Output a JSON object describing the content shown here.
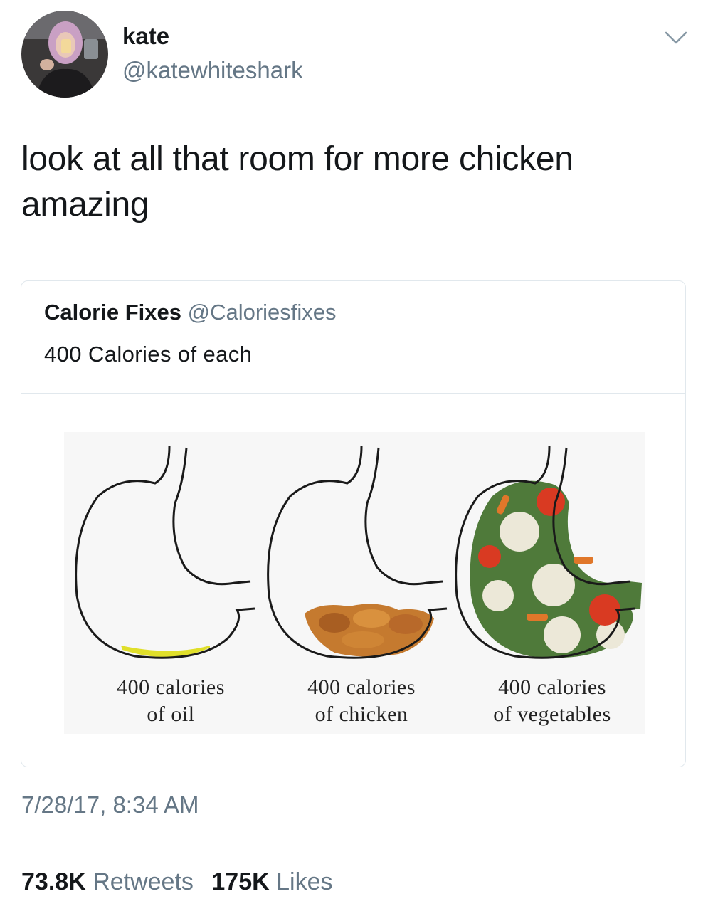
{
  "author": {
    "name": "kate",
    "handle": "@katewhiteshark"
  },
  "tweet": {
    "text_line1": "look at all that room for more chicken",
    "text_line2": "amazing"
  },
  "quoted_tweet": {
    "name": "Calorie Fixes",
    "handle": "@Caloriesfixes",
    "text": "400 Calories of each",
    "image_captions": [
      {
        "line1": "400 calories",
        "line2": "of oil"
      },
      {
        "line1": "400 calories",
        "line2": "of chicken"
      },
      {
        "line1": "400 calories",
        "line2": "of vegetables"
      }
    ]
  },
  "timestamp": "7/28/17, 8:34 AM",
  "stats": {
    "retweets_count": "73.8K",
    "retweets_label": "Retweets",
    "likes_count": "175K",
    "likes_label": "Likes"
  },
  "icons": {
    "menu": "chevron-down-icon"
  },
  "colors": {
    "secondary_text": "#657786",
    "primary_text": "#14171a",
    "border": "#e1e8ed"
  }
}
